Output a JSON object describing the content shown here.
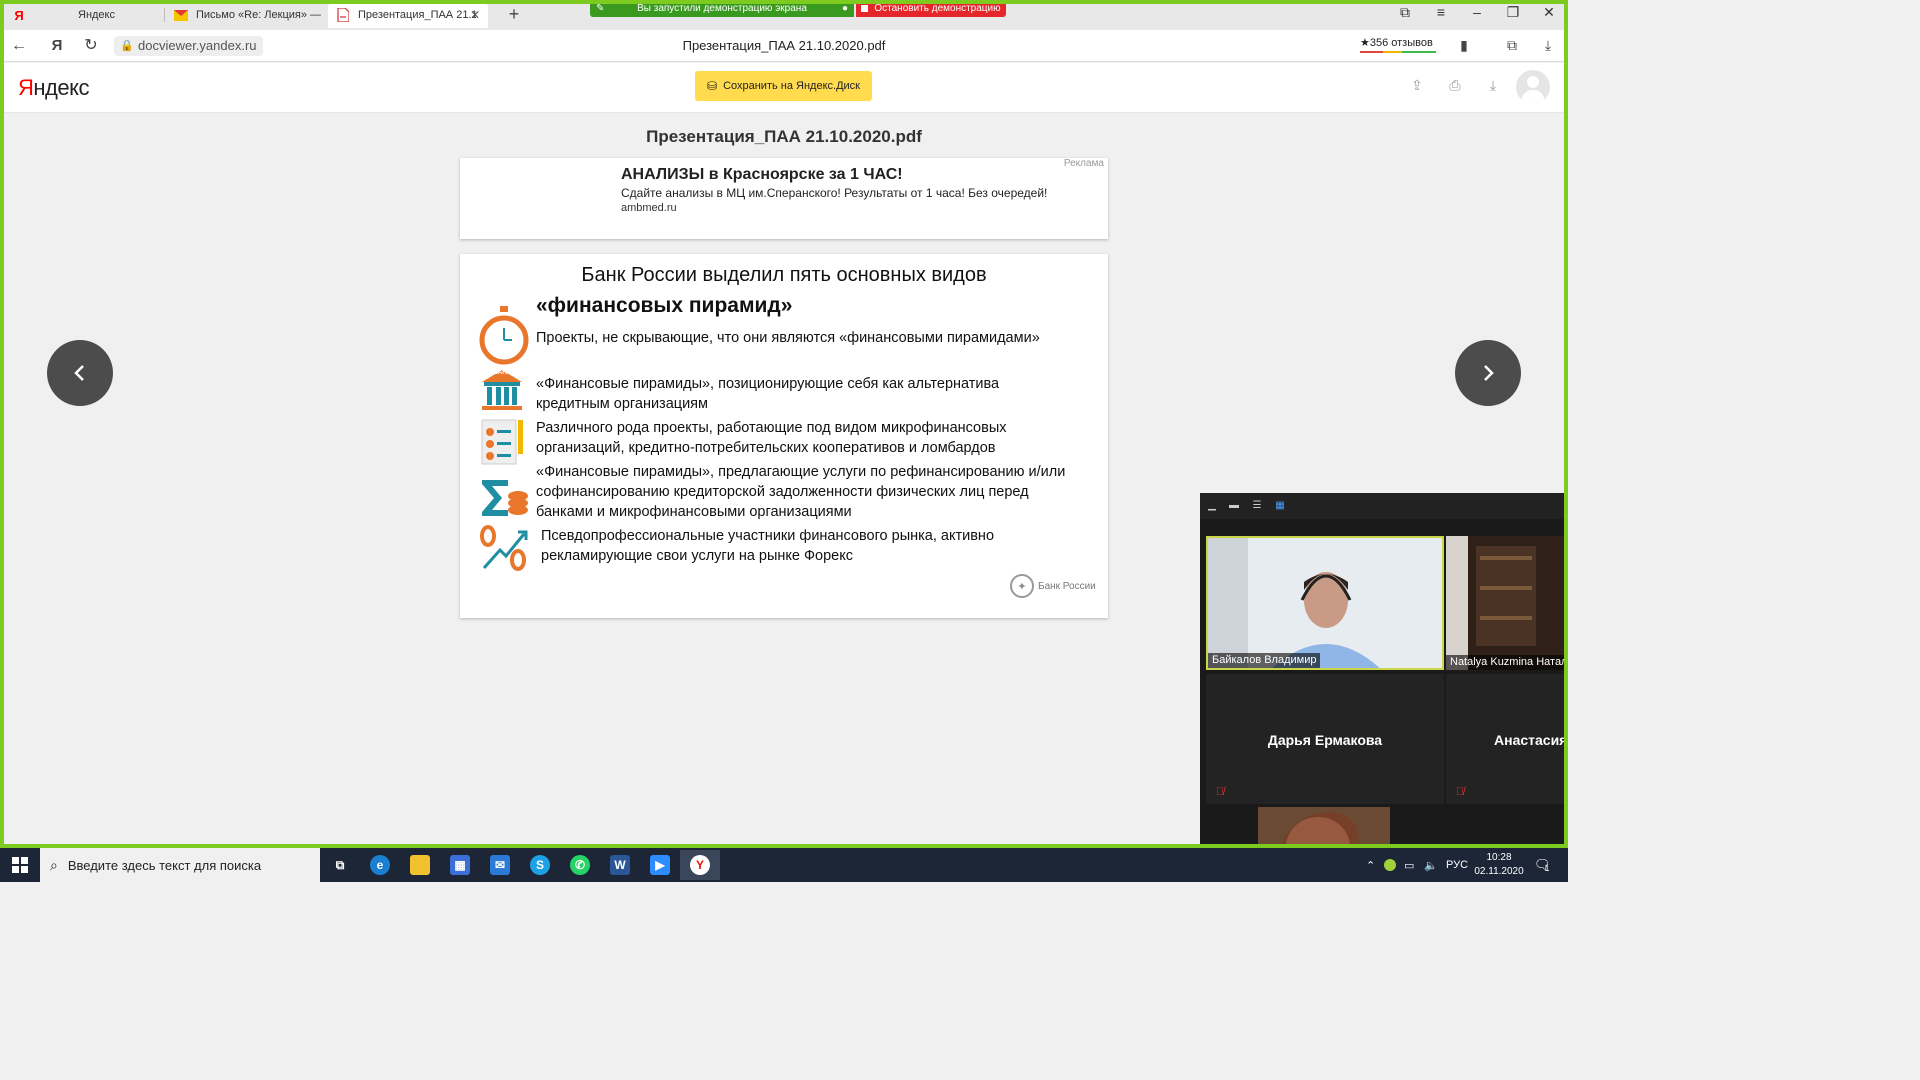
{
  "browser": {
    "tabs": [
      {
        "label": "Яндекс",
        "icon": "yandex-icon"
      },
      {
        "label": "Письмо «Re: Лекция» — Я",
        "icon": "mail-icon"
      },
      {
        "label": "Презентация_ПАА 21.1",
        "icon": "pdf-icon"
      }
    ],
    "share_banner": "Вы запустили демонстрацию экрана",
    "stop_share": "Остановить демонстрацию",
    "url": "docviewer.yandex.ru",
    "page_title": "Презентация_ПАА 21.10.2020.pdf",
    "reviews": "★356 отзывов"
  },
  "yandex": {
    "logo_first": "Я",
    "logo_rest": "ндекс",
    "save_button": "Сохранить на Яндекс.Диск"
  },
  "viewer": {
    "doc_title": "Презентация_ПАА 21.10.2020.pdf",
    "ad": {
      "label": "Реклама",
      "title": "АНАЛИЗЫ в Красноярске за 1 ЧАС!",
      "text": "Сдайте анализы в МЦ им.Сперанского! Результаты от 1 часа! Без очередей!",
      "url": "ambmed.ru"
    },
    "slide": {
      "heading_line1": "Банк России выделил пять основных видов",
      "heading_line2": "«финансовых пирамид»",
      "items": [
        "Проекты, не скрывающие, что они являются «финансовыми пирамидами»",
        "«Финансовые пирамиды», позиционирующие себя как альтернатива кредитным организациям",
        "Различного рода проекты, работающие под видом микрофинансовых организаций, кредитно-потребительских кооперативов и ломбардов",
        "«Финансовые пирамиды», предлагающие услуги по рефинансированию и/или софинансированию кредиторской задолженности физических лиц перед банками и микрофинансовыми организациями",
        "Псевдопрофессиональные участники финансового рынка, активно рекламирующие свои услуги на рынке Форекс"
      ],
      "bank_icon_label": "БАНК",
      "footer_logo": "Банк России"
    }
  },
  "zoom": {
    "participants": [
      {
        "name": "Байкалов Владимир"
      },
      {
        "name": "Natalya Kuzmina Наталья"
      },
      {
        "name": "Дарья Ермакова"
      },
      {
        "name": "Анастасия"
      }
    ]
  },
  "taskbar": {
    "search_placeholder": "Введите здесь текст для поиска",
    "lang": "РУС",
    "time": "10:28",
    "date": "02.11.2020",
    "notifications": "1"
  },
  "colors": {
    "share_frame": "#7ecb20",
    "yandex_yellow": "#ffdb4d",
    "stop_red": "#e5262a",
    "slide_orange": "#e8762b",
    "slide_teal": "#1f8ea3"
  }
}
